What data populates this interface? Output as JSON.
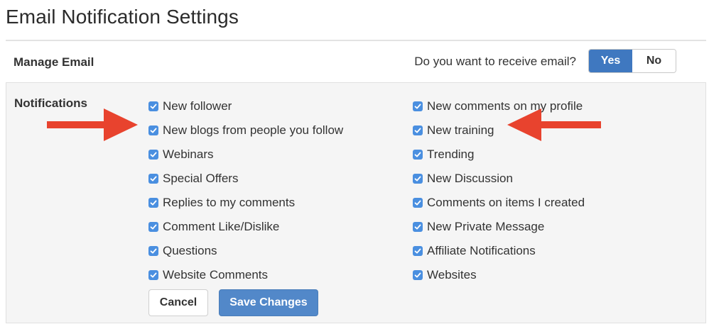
{
  "page": {
    "title": "Email Notification Settings"
  },
  "manage_email": {
    "label": "Manage Email",
    "question": "Do you want to receive email?",
    "options": [
      "Yes",
      "No"
    ],
    "selected": "Yes"
  },
  "notifications": {
    "label": "Notifications",
    "left_options": [
      {
        "label": "New follower",
        "checked": true
      },
      {
        "label": "New blogs from people you follow",
        "checked": true
      },
      {
        "label": "Webinars",
        "checked": true
      },
      {
        "label": "Special Offers",
        "checked": true
      },
      {
        "label": "Replies to my comments",
        "checked": true
      },
      {
        "label": "Comment Like/Dislike",
        "checked": true
      },
      {
        "label": "Questions",
        "checked": true
      },
      {
        "label": "Website Comments",
        "checked": true
      }
    ],
    "right_options": [
      {
        "label": "New comments on my profile",
        "checked": true
      },
      {
        "label": "New training",
        "checked": true
      },
      {
        "label": "Trending",
        "checked": true
      },
      {
        "label": "New Discussion",
        "checked": true
      },
      {
        "label": "Comments on items I created",
        "checked": true
      },
      {
        "label": "New Private Message",
        "checked": true
      },
      {
        "label": "Affiliate Notifications",
        "checked": true
      },
      {
        "label": "Websites",
        "checked": true
      }
    ]
  },
  "actions": {
    "cancel_label": "Cancel",
    "save_label": "Save Changes"
  },
  "annotations": {
    "arrow_icon": "red-arrow-icon",
    "arrow_color": "#e8432e"
  },
  "colors": {
    "primary": "#3f78c0",
    "checkbox": "#4a8fe0",
    "panel_bg": "#f5f5f5"
  }
}
